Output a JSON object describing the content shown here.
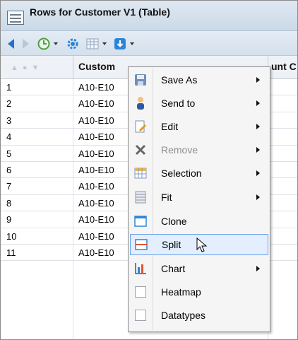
{
  "window": {
    "title": "Rows for Customer V1 (Table)"
  },
  "table": {
    "headers": [
      "Custom",
      "unt C"
    ],
    "row_numbers": [
      "1",
      "2",
      "3",
      "4",
      "5",
      "6",
      "7",
      "8",
      "9",
      "10",
      "11"
    ],
    "cell_values": [
      "A10-E10",
      "A10-E10",
      "A10-E10",
      "A10-E10",
      "A10-E10",
      "A10-E10",
      "A10-E10",
      "A10-E10",
      "A10-E10",
      "A10-E10",
      "A10-E10"
    ]
  },
  "menu": {
    "items": [
      {
        "label": "Save As",
        "icon": "save-icon",
        "submenu": true,
        "disabled": false,
        "highlighted": false
      },
      {
        "label": "Send to",
        "icon": "send-to-icon",
        "submenu": true,
        "disabled": false,
        "highlighted": false
      },
      {
        "label": "Edit",
        "icon": "edit-icon",
        "submenu": true,
        "disabled": false,
        "highlighted": false
      },
      {
        "label": "Remove",
        "icon": "remove-icon",
        "submenu": true,
        "disabled": true,
        "highlighted": false
      },
      {
        "label": "Selection",
        "icon": "selection-icon",
        "submenu": true,
        "disabled": false,
        "highlighted": false
      },
      {
        "label": "Fit",
        "icon": "fit-icon",
        "submenu": true,
        "disabled": false,
        "highlighted": false
      },
      {
        "label": "Clone",
        "icon": "clone-icon",
        "submenu": false,
        "disabled": false,
        "highlighted": false
      },
      {
        "label": "Split",
        "icon": "split-icon",
        "submenu": false,
        "disabled": false,
        "highlighted": true
      },
      {
        "label": "Chart",
        "icon": "chart-icon",
        "submenu": true,
        "disabled": false,
        "highlighted": false
      },
      {
        "label": "Heatmap",
        "icon": "checkbox-icon",
        "submenu": false,
        "disabled": false,
        "highlighted": false
      },
      {
        "label": "Datatypes",
        "icon": "checkbox-icon",
        "submenu": false,
        "disabled": false,
        "highlighted": false
      }
    ]
  },
  "colors": {
    "accent": "#2a6fc9",
    "highlight_bg": "#e3efff",
    "highlight_border": "#6ba1e6",
    "disabled_text": "#8e8e8e"
  }
}
